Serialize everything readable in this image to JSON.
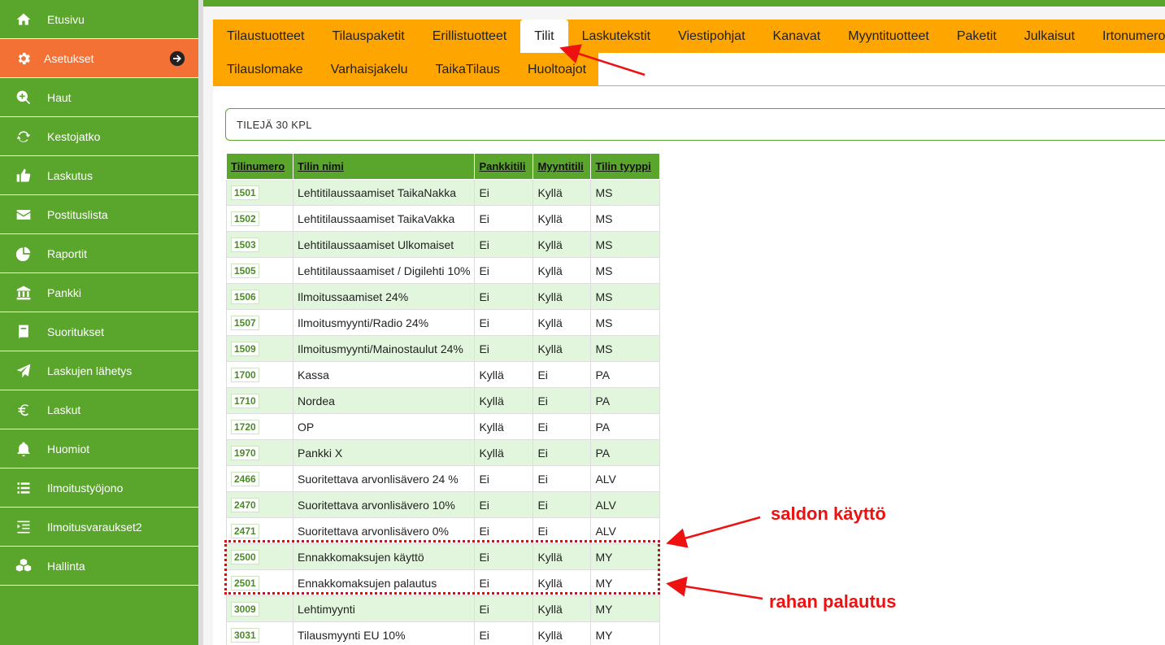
{
  "sidebar": {
    "items": [
      {
        "label": "Etusivu",
        "icon": "home-icon"
      },
      {
        "label": "Asetukset",
        "icon": "gear-icon",
        "active": true
      },
      {
        "label": "Haut",
        "icon": "search-plus-icon"
      },
      {
        "label": "Kestojatko",
        "icon": "refresh-icon"
      },
      {
        "label": "Laskutus",
        "icon": "thumbs-up-icon"
      },
      {
        "label": "Postituslista",
        "icon": "envelope-icon"
      },
      {
        "label": "Raportit",
        "icon": "pie-chart-icon"
      },
      {
        "label": "Pankki",
        "icon": "bank-icon"
      },
      {
        "label": "Suoritukset",
        "icon": "book-icon"
      },
      {
        "label": "Laskujen lähetys",
        "icon": "paper-plane-icon"
      },
      {
        "label": "Laskut",
        "icon": "euro-icon"
      },
      {
        "label": "Huomiot",
        "icon": "bell-icon"
      },
      {
        "label": "Ilmoitustyöjono",
        "icon": "list-icon"
      },
      {
        "label": "Ilmoitusvaraukset2",
        "icon": "indent-list-icon"
      },
      {
        "label": "Hallinta",
        "icon": "cubes-icon"
      }
    ]
  },
  "tabs": {
    "row1": [
      "Tilaustuotteet",
      "Tilauspaketit",
      "Erillistuotteet",
      "Tilit",
      "Laskutekstit",
      "Viestipohjat",
      "Kanavat",
      "Myyntituotteet",
      "Paketit",
      "Julkaisut",
      "Irtonumero"
    ],
    "row2": [
      "Tilauslomake",
      "Varhaisjakelu",
      "TaikaTilaus",
      "Huoltoajot"
    ],
    "active": "Tilit"
  },
  "panel": {
    "title": "TILEJÄ 30 KPL"
  },
  "table": {
    "headers": [
      "Tilinumero",
      "Tilin nimi",
      "Pankkitili",
      "Myyntitili",
      "Tilin tyyppi"
    ],
    "rows": [
      [
        "1501",
        "Lehtitilaussaamiset TaikaNakka",
        "Ei",
        "Kyllä",
        "MS"
      ],
      [
        "1502",
        "Lehtitilaussaamiset TaikaVakka",
        "Ei",
        "Kyllä",
        "MS"
      ],
      [
        "1503",
        "Lehtitilaussaamiset Ulkomaiset",
        "Ei",
        "Kyllä",
        "MS"
      ],
      [
        "1505",
        "Lehtitilaussaamiset / Digilehti 10%",
        "Ei",
        "Kyllä",
        "MS"
      ],
      [
        "1506",
        "Ilmoitussaamiset 24%",
        "Ei",
        "Kyllä",
        "MS"
      ],
      [
        "1507",
        "Ilmoitusmyynti/Radio 24%",
        "Ei",
        "Kyllä",
        "MS"
      ],
      [
        "1509",
        "Ilmoitusmyynti/Mainostaulut 24%",
        "Ei",
        "Kyllä",
        "MS"
      ],
      [
        "1700",
        "Kassa",
        "Kyllä",
        "Ei",
        "PA"
      ],
      [
        "1710",
        "Nordea",
        "Kyllä",
        "Ei",
        "PA"
      ],
      [
        "1720",
        "OP",
        "Kyllä",
        "Ei",
        "PA"
      ],
      [
        "1970",
        "Pankki X",
        "Kyllä",
        "Ei",
        "PA"
      ],
      [
        "2466",
        "Suoritettava arvonlisävero 24 %",
        "Ei",
        "Ei",
        "ALV"
      ],
      [
        "2470",
        "Suoritettava arvonlisävero 10%",
        "Ei",
        "Ei",
        "ALV"
      ],
      [
        "2471",
        "Suoritettava arvonlisävero 0%",
        "Ei",
        "Ei",
        "ALV"
      ],
      [
        "2500",
        "Ennakkomaksujen käyttö",
        "Ei",
        "Kyllä",
        "MY"
      ],
      [
        "2501",
        "Ennakkomaksujen palautus",
        "Ei",
        "Kyllä",
        "MY"
      ],
      [
        "3009",
        "Lehtimyynti",
        "Ei",
        "Kyllä",
        "MY"
      ],
      [
        "3031",
        "Tilausmyynti EU 10%",
        "Ei",
        "Kyllä",
        "MY"
      ]
    ]
  },
  "annotations": {
    "saldon": "saldon käyttö",
    "rahan": "rahan palautus"
  },
  "colors": {
    "sidebar": "#5aa52c",
    "active_item": "#f37135",
    "tabs": "#ffa500",
    "row_alt": "#e2f5dd",
    "annotation": "#ee1111"
  }
}
